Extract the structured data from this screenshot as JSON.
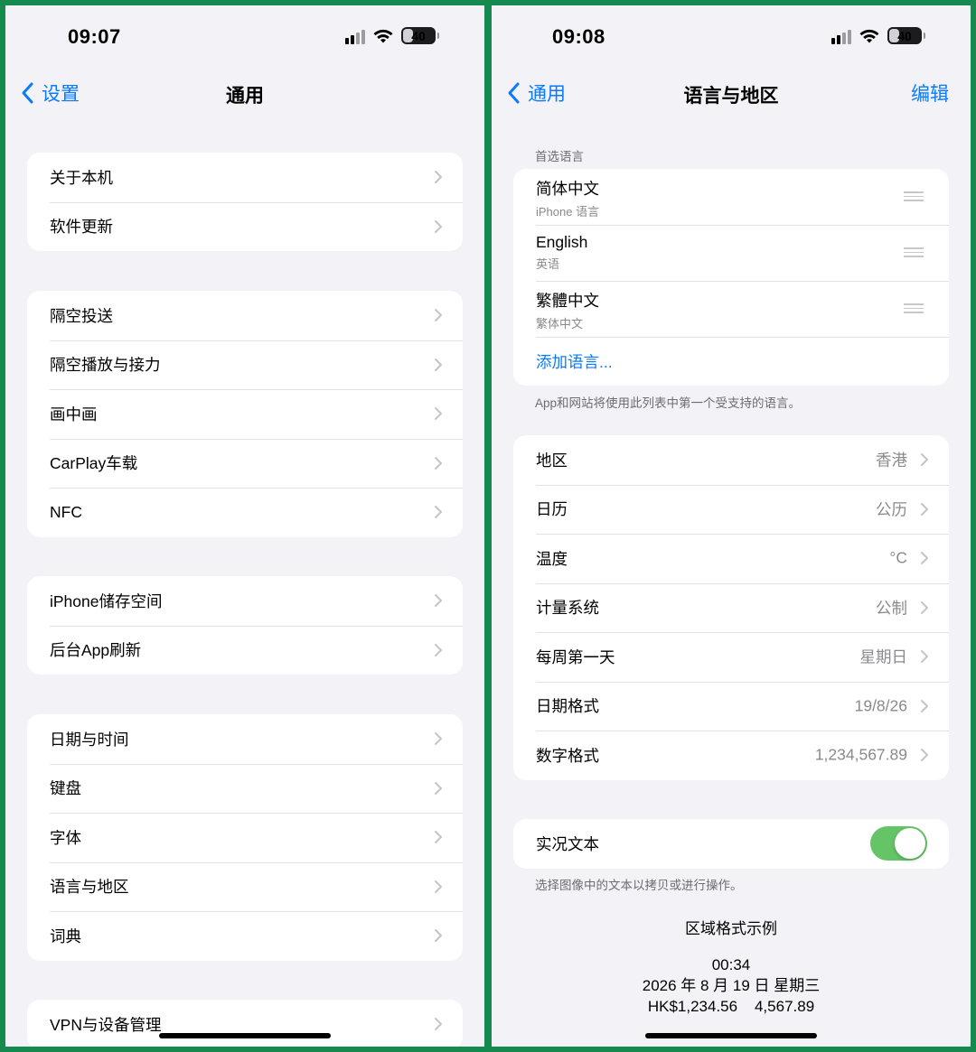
{
  "left": {
    "status": {
      "time": "09:07",
      "battery": "40",
      "battery_level_percent": 40
    },
    "nav": {
      "back_label": "设置",
      "title": "通用"
    },
    "groups": [
      {
        "items": [
          "关于本机",
          "软件更新"
        ]
      },
      {
        "items": [
          "隔空投送",
          "隔空播放与接力",
          "画中画",
          "CarPlay车载",
          "NFC"
        ]
      },
      {
        "items": [
          "iPhone储存空间",
          "后台App刷新"
        ]
      },
      {
        "items": [
          "日期与时间",
          "键盘",
          "字体",
          "语言与地区",
          "词典"
        ]
      },
      {
        "items": [
          "VPN与设备管理"
        ]
      }
    ]
  },
  "right": {
    "status": {
      "time": "09:08",
      "battery": "40",
      "battery_level_percent": 40
    },
    "nav": {
      "back_label": "通用",
      "title": "语言与地区",
      "action_label": "编辑"
    },
    "preferred_languages": {
      "header": "首选语言",
      "languages": [
        {
          "name": "简体中文",
          "subtitle": "iPhone 语言"
        },
        {
          "name": "English",
          "subtitle": "英语"
        },
        {
          "name": "繁體中文",
          "subtitle": "繁体中文"
        }
      ],
      "add_label": "添加语言...",
      "footnote": "App和网站将使用此列表中第一个受支持的语言。"
    },
    "region_settings": [
      {
        "label": "地区",
        "value": "香港"
      },
      {
        "label": "日历",
        "value": "公历"
      },
      {
        "label": "温度",
        "value": "°C"
      },
      {
        "label": "计量系统",
        "value": "公制"
      },
      {
        "label": "每周第一天",
        "value": "星期日"
      },
      {
        "label": "日期格式",
        "value": "19/8/26"
      },
      {
        "label": "数字格式",
        "value": "1,234,567.89"
      }
    ],
    "live_text": {
      "label": "实况文本",
      "enabled": true,
      "footnote": "选择图像中的文本以拷贝或进行操作。"
    },
    "format_example": {
      "title": "区域格式示例",
      "time": "00:34",
      "date": "2026 年 8 月 19 日 星期三",
      "numbers": "HK$1,234.56    4,567.89"
    }
  },
  "colors": {
    "accent": "#0a7aff",
    "toggle_on": "#65c466",
    "frame": "#168a4e",
    "background": "#f2f2f7"
  }
}
